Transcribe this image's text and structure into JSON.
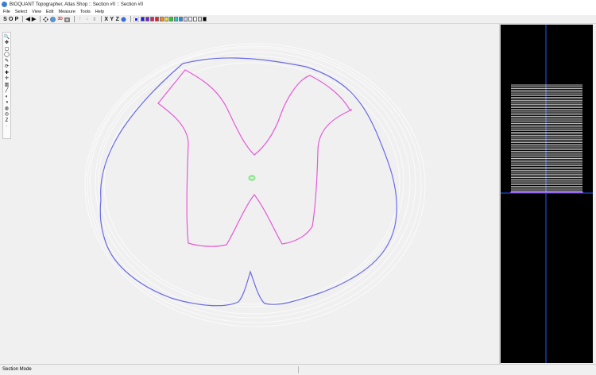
{
  "window": {
    "title": "BIOQUANT Topographer, Atlas Shop :: Section #0 :: Section #0"
  },
  "menu": [
    "File",
    "Select",
    "View",
    "Edit",
    "Measure",
    "Tools",
    "Help"
  ],
  "toolbar": {
    "s_label": "S",
    "o_label": "O",
    "p_label": "P",
    "prev_icon": "◀",
    "next_icon": "▶",
    "x_label": "X",
    "y_label": "Y",
    "z_label": "Z"
  },
  "palette": [
    "#1a1aff",
    "#7a1ad6",
    "#e01a6a",
    "#ff1a1a",
    "#ff8a1a",
    "#ffe51a",
    "#1ad61a",
    "#1ad6c8",
    "#1a8aff",
    "#cfd8ff",
    "#f0f0ff",
    "#ffffff",
    "#e0e0e0",
    "#000000"
  ],
  "left_tools": [
    "🔍",
    "✥",
    "▢",
    "◯",
    "✎",
    "⟳",
    "✚",
    "✛",
    "▥",
    "╱",
    "◐",
    "◑",
    "◍",
    "◎",
    "Z",
    "·"
  ],
  "statusbar": {
    "mode": "Section Mode"
  },
  "colors": {
    "outer_contour": "#6a6ae6",
    "inner_contour": "#e65ad8",
    "center_marker": "#4ae04a",
    "side_line": "#1a5aff"
  }
}
